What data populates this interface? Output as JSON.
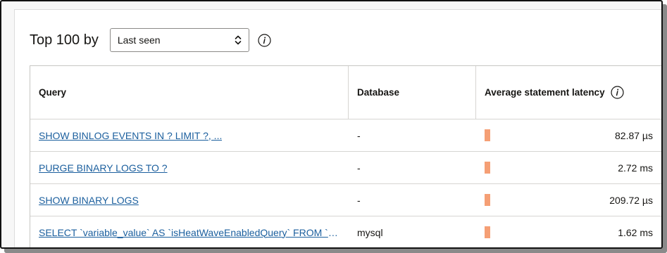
{
  "toolbar": {
    "title": "Top 100 by",
    "sort_select": {
      "value": "Last seen"
    },
    "info_icon": "info-circle-icon"
  },
  "table": {
    "columns": [
      {
        "label": "Query"
      },
      {
        "label": "Database"
      },
      {
        "label": "Average statement latency",
        "icon": "info-circle-icon"
      }
    ],
    "rows": [
      {
        "query": "SHOW BINLOG EVENTS IN ? LIMIT ?, ...",
        "database": "-",
        "latency": "82.87 µs",
        "bar_fraction": 0.01
      },
      {
        "query": "PURGE BINARY LOGS TO ?",
        "database": "-",
        "latency": "2.72 ms",
        "bar_fraction": 0.01
      },
      {
        "query": "SHOW BINARY LOGS",
        "database": "-",
        "latency": "209.72 µs",
        "bar_fraction": 0.01
      },
      {
        "query": "SELECT `variable_value` AS `isHeatWaveEnabledQuery` FROM `p...",
        "database": "mysql",
        "latency": "1.62 ms",
        "bar_fraction": 0.01
      }
    ]
  },
  "colors": {
    "bar": "#f59f75",
    "link": "#1b5f9e"
  }
}
